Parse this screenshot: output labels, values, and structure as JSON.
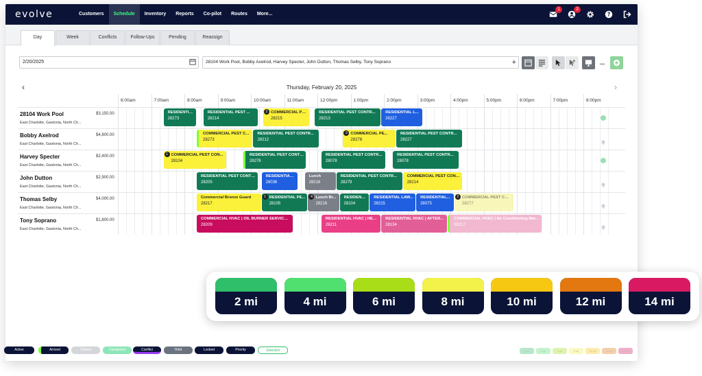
{
  "app": {
    "logo": "evolve",
    "nav": [
      "Customers",
      "Schedule",
      "Inventory",
      "Reports",
      "Co-pilot",
      "Routes",
      "More..."
    ],
    "active_nav": "Schedule",
    "notifications": {
      "mail_badge": "1",
      "user_badge": "2"
    }
  },
  "tabs": [
    "Day",
    "Week",
    "Conflicts",
    "Follow-Ups",
    "Pending",
    "Reassign"
  ],
  "active_tab": "Day",
  "filters": {
    "date": "2/20/2025",
    "technicians": "28104 Work Pool, Bobby Axelrod, Harvey Specter, John Dutton, Thomas Selby, Tony Soprano"
  },
  "schedule": {
    "date_title": "Thursday, February 20, 2025",
    "times": [
      "6:00am",
      "7:00am",
      "8:00am",
      "9:00am",
      "10:00am",
      "11:00am",
      "12:00pm",
      "1:00pm",
      "2:00pm",
      "3:00pm",
      "4:00pm",
      "5:00pm",
      "6:00pm",
      "7:00pm",
      "8:00pm"
    ],
    "rows": [
      {
        "name": "28104 Work Pool",
        "address": "East Charlotte, Gastonia, North Ch...",
        "amount": "$3,150.00",
        "status": "check"
      },
      {
        "name": "Bobby Axelrod",
        "address": "East Charlotte, Gastonia, North Ch...",
        "amount": "$4,800.00",
        "status": "pin"
      },
      {
        "name": "Harvey Specter",
        "address": "East Charlotte, Gastonia, North Ch...",
        "amount": "$2,400.00",
        "status": "check"
      },
      {
        "name": "John Dutton",
        "address": "East Charlotte, Gastonia, North Ch...",
        "amount": "$2,900.00",
        "status": "pin"
      },
      {
        "name": "Thomas Selby",
        "address": "East Charlotte, Gastonia, North Ch...",
        "amount": "$4,000.00",
        "status": "pin"
      },
      {
        "name": "Tony Soprano",
        "address": "East Charlotte, Gastonia, North Ch...",
        "amount": "$1,800.00",
        "status": "pin"
      }
    ],
    "jobs": [
      {
        "row": 0,
        "start": 7.0,
        "end": 8.0,
        "title": "RESIDENTIAL...",
        "number": "28273",
        "color": "green"
      },
      {
        "row": 0,
        "start": 8.2,
        "end": 9.85,
        "title": "RESIDENTIAL PEST ...",
        "number": "28214",
        "color": "green"
      },
      {
        "row": 0,
        "start": 10.0,
        "end": 11.4,
        "title": "COMMERCIAL PE...",
        "number": "28215",
        "color": "yellow",
        "marker": "2"
      },
      {
        "row": 0,
        "start": 11.55,
        "end": 13.55,
        "title": "RESIDENTIAL PEST CONTR...",
        "number": "28213",
        "color": "green"
      },
      {
        "row": 0,
        "start": 13.55,
        "end": 14.8,
        "title": "RESIDENTIAL L...",
        "number": "28227",
        "color": "blue"
      },
      {
        "row": 1,
        "start": 8.0,
        "end": 9.7,
        "title": "COMMERCIAL PEST C...",
        "number": "28273",
        "color": "yellow",
        "edge": true
      },
      {
        "row": 1,
        "start": 9.7,
        "end": 11.7,
        "title": "RESIDENTIAL PEST CONTR...",
        "number": "28212",
        "color": "green"
      },
      {
        "row": 1,
        "start": 12.4,
        "end": 14.0,
        "title": "COMMERCIAL PE...",
        "number": "28278",
        "color": "yellow",
        "marker": "3"
      },
      {
        "row": 1,
        "start": 14.0,
        "end": 16.0,
        "title": "RESIDENTIAL PEST CONTR...",
        "number": "28227",
        "color": "green"
      },
      {
        "row": 2,
        "start": 7.0,
        "end": 8.9,
        "title": "COMMERCIAL PEST CON...",
        "number": "28104",
        "color": "yellow",
        "marker": "1"
      },
      {
        "row": 2,
        "start": 9.4,
        "end": 11.3,
        "title": "RESIDENTIAL PEST CONTR...",
        "number": "28278",
        "color": "green",
        "edge": true
      },
      {
        "row": 2,
        "start": 11.75,
        "end": 13.7,
        "title": "RESIDENTIAL PEST CONTR...",
        "number": "28078",
        "color": "green"
      },
      {
        "row": 2,
        "start": 13.9,
        "end": 15.9,
        "title": "RESIDENTIAL PEST CONTR...",
        "number": "28078",
        "color": "green"
      },
      {
        "row": 3,
        "start": 8.0,
        "end": 9.85,
        "title": "RESIDENTIAL PEST CONTR...",
        "number": "28205",
        "color": "green"
      },
      {
        "row": 3,
        "start": 9.95,
        "end": 11.05,
        "title": "RESIDENTIAL...",
        "number": "28036",
        "color": "blue"
      },
      {
        "row": 3,
        "start": 11.25,
        "end": 12.2,
        "title": "Lunch",
        "number": "28216",
        "color": "gray"
      },
      {
        "row": 3,
        "start": 12.2,
        "end": 14.2,
        "title": "RESIDENTIAL PEST CONTR...",
        "number": "28279",
        "color": "green"
      },
      {
        "row": 3,
        "start": 14.2,
        "end": 16.0,
        "title": "COMMERCIAL PEST CONTR...",
        "number": "28214",
        "color": "yellow"
      },
      {
        "row": 4,
        "start": 8.0,
        "end": 9.95,
        "title": "Commercial Bronze Guard",
        "number": "28217",
        "color": "yellow"
      },
      {
        "row": 4,
        "start": 9.95,
        "end": 11.35,
        "title": "RESIDENTIAL PE...",
        "number": "28105",
        "color": "green",
        "marker": "1"
      },
      {
        "row": 4,
        "start": 11.35,
        "end": 12.3,
        "title": "Lunch Br...",
        "number": "28216",
        "color": "gray",
        "marker": "4"
      },
      {
        "row": 4,
        "start": 12.3,
        "end": 13.2,
        "title": "RESIDENTIAL...",
        "number": "28104",
        "color": "green"
      },
      {
        "row": 4,
        "start": 13.2,
        "end": 14.6,
        "title": "RESIDENTIAL LAW...",
        "number": "28215",
        "color": "blue"
      },
      {
        "row": 4,
        "start": 14.6,
        "end": 15.75,
        "title": "RESIDENTIAL...",
        "number": "28075",
        "color": "blue"
      },
      {
        "row": 4,
        "start": 15.75,
        "end": 17.55,
        "title": "COMMERCIAL PEST CONTR...",
        "number": "28277",
        "color": "yellow-faded",
        "marker": "2"
      },
      {
        "row": 5,
        "start": 8.0,
        "end": 10.9,
        "title": "COMMERCIAL HVAC | OIL BURNER SERVICE ...",
        "number": "28209",
        "color": "magenta"
      },
      {
        "row": 5,
        "start": 11.75,
        "end": 13.55,
        "title": "RESIDENTIAL HVAC | HEAT...",
        "number": "28211",
        "color": "pink"
      },
      {
        "row": 5,
        "start": 13.55,
        "end": 15.55,
        "title": "RESIDENTIAL HVAC | AFTER...",
        "number": "28134",
        "color": "pink-mid"
      },
      {
        "row": 5,
        "start": 15.55,
        "end": 18.4,
        "title": "COMMERCIAL HVAC | Air Conditioning Main...",
        "number": "28217",
        "color": "pink-faded",
        "edge": true
      }
    ]
  },
  "distance_legend": [
    {
      "label": "2 mi",
      "color": "#2fbf6b"
    },
    {
      "label": "4 mi",
      "color": "#4fe070"
    },
    {
      "label": "6 mi",
      "color": "#a8dd18"
    },
    {
      "label": "8 mi",
      "color": "#f3f24a"
    },
    {
      "label": "10 mi",
      "color": "#f7c812"
    },
    {
      "label": "12 mi",
      "color": "#e2780f"
    },
    {
      "label": "14 mi",
      "color": "#d91a63"
    }
  ],
  "status_legend": [
    {
      "label": "Active",
      "bg": "#0b1437",
      "fg": "#ffffff"
    },
    {
      "label": "Arrived",
      "bg": "#0b1437",
      "fg": "#ffffff"
    },
    {
      "label": "Closed",
      "bg": "#d4d6da",
      "fg": "#ffffff"
    },
    {
      "label": "Completed",
      "bg": "#8ee6b8",
      "fg": "#ffffff"
    },
    {
      "label": "Conflict",
      "bg": "#0b1437",
      "fg": "#ffffff"
    },
    {
      "label": "Hold",
      "bg": "#6b7280",
      "fg": "#ffffff"
    },
    {
      "label": "Locked",
      "bg": "#0b1437",
      "fg": "#ffffff"
    },
    {
      "label": "Priority",
      "bg": "#0b1437",
      "fg": "#ffffff"
    },
    {
      "label": "Selected",
      "bg": "#ffffff",
      "fg": "#2fbf6b"
    }
  ],
  "colors": {
    "brand_navy": "#0b1437",
    "accent_green": "#39ff7a",
    "job_green": "#117a55",
    "job_yellow": "#fbf03a",
    "job_blue": "#1f5fe0",
    "job_gray": "#7b7f87",
    "job_magenta": "#c80d5e",
    "job_pink": "#ea3f86"
  }
}
